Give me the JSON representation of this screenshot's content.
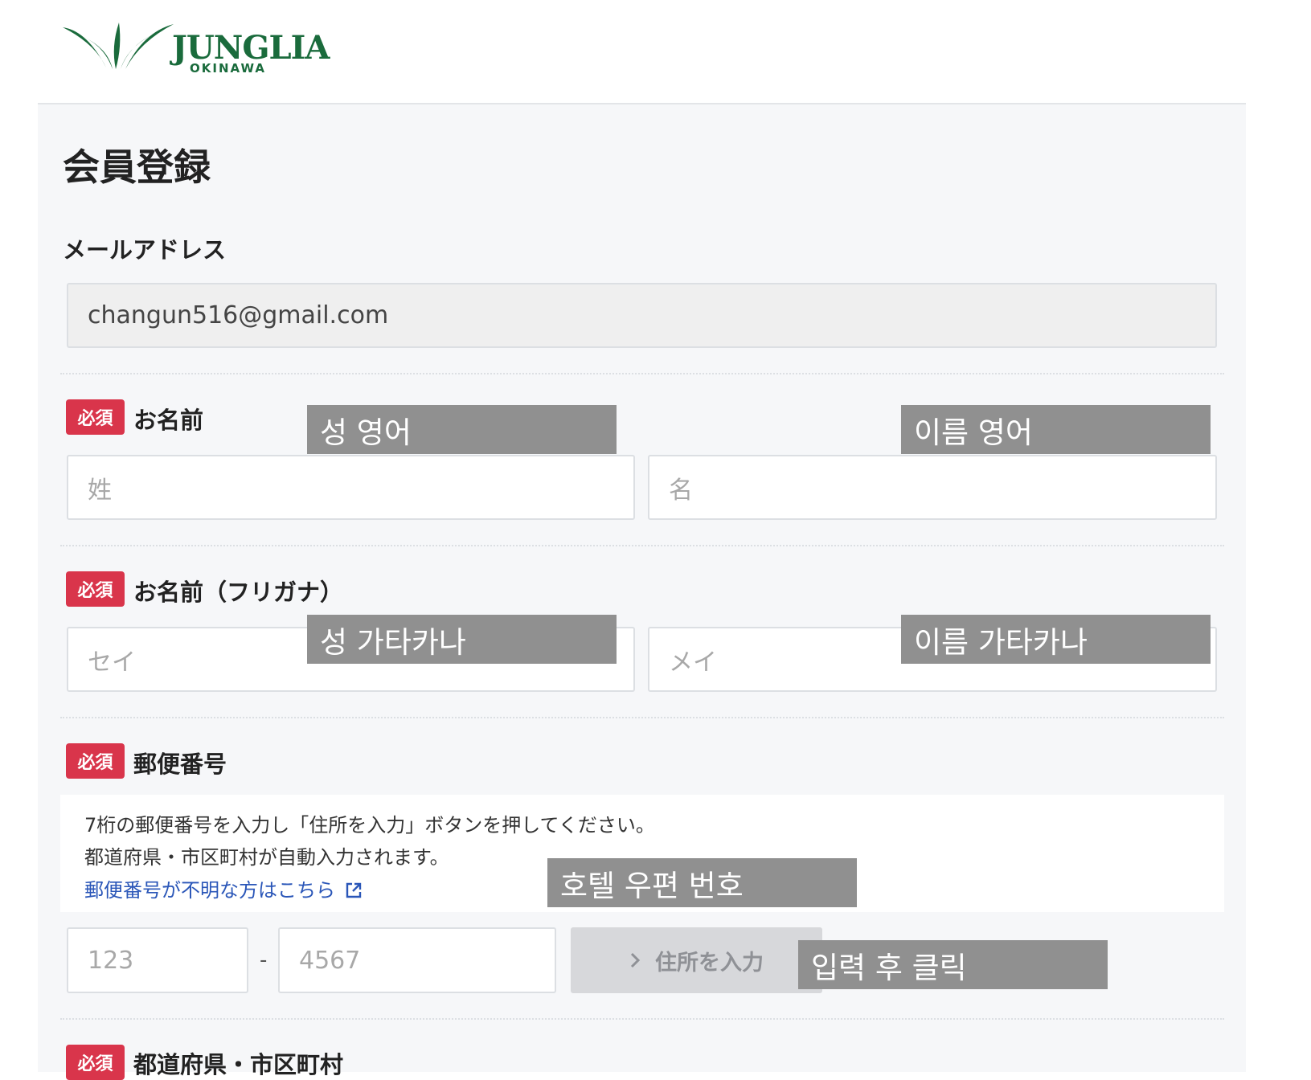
{
  "header": {
    "logo_word": "JUNGLIA",
    "logo_sub": "OKINAWA"
  },
  "page": {
    "title": "会員登録"
  },
  "email": {
    "label": "メールアドレス",
    "value": "changun516@gmail.com"
  },
  "required_badge": "必須",
  "name": {
    "label": "お名前",
    "last_placeholder": "姓",
    "first_placeholder": "名"
  },
  "furigana": {
    "label": "お名前（フリガナ）",
    "last_placeholder": "セイ",
    "first_placeholder": "メイ"
  },
  "postal": {
    "label": "郵便番号",
    "info_line1": "7桁の郵便番号を入力し「住所を入力」ボタンを押してください。",
    "info_line2": "都道府県・市区町村が自動入力されます。",
    "help_link": "郵便番号が不明な方はこちら",
    "part1_placeholder": "123",
    "separator": "-",
    "part2_placeholder": "4567",
    "button_label": "住所を入力"
  },
  "prefecture": {
    "label": "都道府県・市区町村"
  },
  "annotations": {
    "last_name_en": "성 영어",
    "first_name_en": "이름 영어",
    "last_name_kana": "성 가타카나",
    "first_name_kana": "이름 가타카나",
    "hotel_postal": "호텔 우편 번호",
    "click_after": "입력 후 클릭"
  },
  "colors": {
    "brand": "#1a6b3c",
    "required": "#d9354b",
    "link": "#2a56b8",
    "overlay": "#909090"
  }
}
